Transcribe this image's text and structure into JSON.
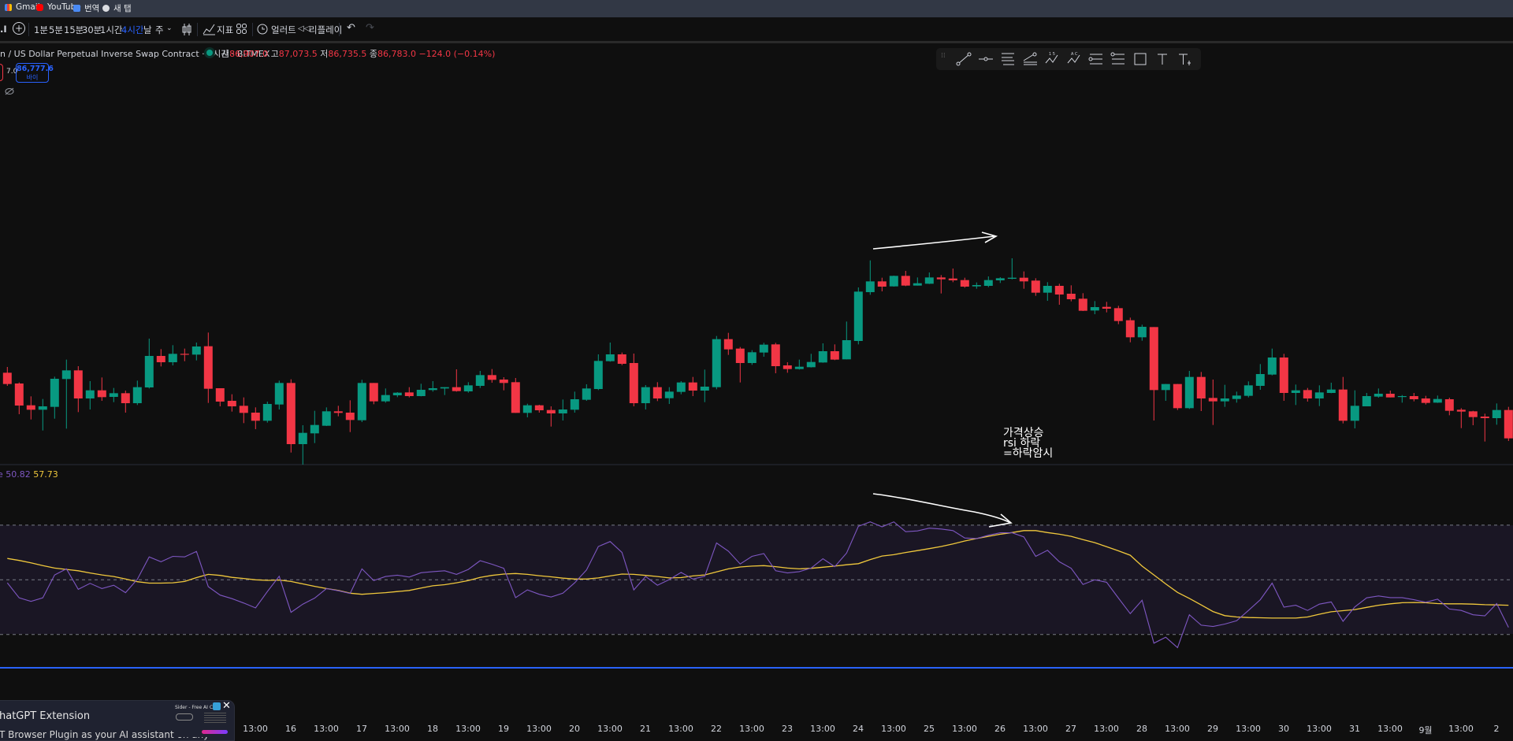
{
  "bookmarks": [
    {
      "label": "Gmail",
      "icon": "gmail-icon"
    },
    {
      "label": "YouTube",
      "icon": "youtube-icon"
    },
    {
      "label": "번역",
      "icon": "translate-icon"
    },
    {
      "label": "새 탭",
      "icon": "globe-icon"
    }
  ],
  "toolbar": {
    "symbol_fragment": ".I",
    "intervals": [
      "1분",
      "5분",
      "15분",
      "30분",
      "1시간",
      "4시간",
      "날",
      "주"
    ],
    "active_interval": "4시간",
    "indicators_label": "지표",
    "alert_label": "얼러트",
    "replay_label": "리플레이"
  },
  "legend": {
    "symbol_title": "n / US Dollar Perpetual Inverse Swap Contract · 4시간 · BITMEX",
    "open_label": "시",
    "open": "86,907.0",
    "high_label": "고",
    "high": "87,073.5",
    "low_label": "저",
    "low": "86,735.5",
    "close_label": "종",
    "close": "86,783.0",
    "change": "−124.0 (−0.14%)",
    "spread": "7.0",
    "buy_price": "86,777.6",
    "buy_label": "바이"
  },
  "drawing_tools": [
    "trend-line-icon",
    "horizontal-ray-icon",
    "parallel-channel-icon",
    "fib-retracement-icon",
    "elliott-wave-icon",
    "abcd-pattern-icon",
    "long-position-icon",
    "short-position-icon",
    "rectangle-icon",
    "text-icon",
    "anchored-text-icon"
  ],
  "annotation_text": [
    "가격상승",
    "rsi 하락",
    "=하락암시"
  ],
  "rsi_legend": {
    "prefix": "e",
    "rsi": "50.82",
    "rsi_ma": "57.73"
  },
  "colors": {
    "up": "#089981",
    "down": "#f23645",
    "rsi": "#7e57c2",
    "rsi_ma": "#f0c83c",
    "accent": "#2962ff"
  },
  "time_axis": [
    "13:00",
    "16",
    "13:00",
    "17",
    "13:00",
    "18",
    "13:00",
    "19",
    "13:00",
    "20",
    "13:00",
    "21",
    "13:00",
    "22",
    "13:00",
    "23",
    "13:00",
    "24",
    "13:00",
    "25",
    "13:00",
    "26",
    "13:00",
    "27",
    "13:00",
    "28",
    "13:00",
    "29",
    "13:00",
    "30",
    "13:00",
    "31",
    "13:00",
    "9월",
    "13:00",
    "2"
  ],
  "popup": {
    "title": "hatGPT Extension",
    "body": "T Browser Plugin as your AI assistant on any",
    "ad_title": "Sider - Free AI C"
  },
  "chart_data": {
    "type": "candlestick",
    "interval": "4h",
    "candles": [
      [
        87033,
        87055,
        86983,
        86990
      ],
      [
        86992,
        86996,
        86875,
        86908
      ],
      [
        86909,
        86943,
        86855,
        86892
      ],
      [
        86892,
        86933,
        86813,
        86905
      ],
      [
        86903,
        87018,
        86858,
        87010
      ],
      [
        87009,
        87083,
        86820,
        87042
      ],
      [
        87042,
        87058,
        86883,
        86935
      ],
      [
        86935,
        87001,
        86893,
        86966
      ],
      [
        86966,
        87015,
        86926,
        86940
      ],
      [
        86941,
        86975,
        86921,
        86955
      ],
      [
        86955,
        86965,
        86881,
        86917
      ],
      [
        86917,
        87003,
        86910,
        86978
      ],
      [
        86977,
        87163,
        86973,
        87097
      ],
      [
        87097,
        87123,
        87057,
        87073
      ],
      [
        87073,
        87138,
        87061,
        87105
      ],
      [
        87105,
        87125,
        87077,
        87102
      ],
      [
        87102,
        87148,
        87080,
        87133
      ],
      [
        87134,
        87186,
        86918,
        86972
      ],
      [
        86974,
        86974,
        86905,
        86923
      ],
      [
        86926,
        86951,
        86885,
        86905
      ],
      [
        86907,
        86939,
        86841,
        86880
      ],
      [
        86881,
        86901,
        86818,
        86850
      ],
      [
        86850,
        86923,
        86843,
        86914
      ],
      [
        86912,
        87003,
        86893,
        86994
      ],
      [
        86994,
        87008,
        86729,
        86761
      ],
      [
        86761,
        86833,
        86683,
        86804
      ],
      [
        86802,
        86888,
        86765,
        86834
      ],
      [
        86831,
        86901,
        86830,
        86886
      ],
      [
        86886,
        86907,
        86867,
        86880
      ],
      [
        86881,
        86928,
        86807,
        86853
      ],
      [
        86852,
        87006,
        86845,
        86994
      ],
      [
        86994,
        86994,
        86913,
        86924
      ],
      [
        86924,
        86973,
        86919,
        86948
      ],
      [
        86947,
        86959,
        86940,
        86957
      ],
      [
        86958,
        86978,
        86939,
        86944
      ],
      [
        86944,
        86991,
        86943,
        86968
      ],
      [
        86967,
        87001,
        86961,
        86974
      ],
      [
        86973,
        86978,
        86948,
        86978
      ],
      [
        86978,
        87046,
        86961,
        86963
      ],
      [
        86962,
        86997,
        86957,
        86985
      ],
      [
        86983,
        87040,
        86975,
        87024
      ],
      [
        87024,
        87047,
        86995,
        87006
      ],
      [
        87007,
        87016,
        86966,
        86994
      ],
      [
        86997,
        87013,
        86880,
        86880
      ],
      [
        86880,
        86915,
        86863,
        86909
      ],
      [
        86909,
        86911,
        86881,
        86890
      ],
      [
        86891,
        86905,
        86828,
        86878
      ],
      [
        86878,
        86931,
        86851,
        86893
      ],
      [
        86892,
        86961,
        86881,
        86932
      ],
      [
        86930,
        86989,
        86926,
        86973
      ],
      [
        86971,
        87103,
        86967,
        87078
      ],
      [
        87077,
        87148,
        87075,
        87103
      ],
      [
        87103,
        87110,
        87062,
        87067
      ],
      [
        87070,
        87106,
        86905,
        86917
      ],
      [
        86917,
        86986,
        86893,
        86978
      ],
      [
        86978,
        86997,
        86925,
        86935
      ],
      [
        86936,
        86978,
        86914,
        86961
      ],
      [
        86960,
        87001,
        86951,
        86996
      ],
      [
        86996,
        87017,
        86944,
        86965
      ],
      [
        86965,
        87045,
        86921,
        86980
      ],
      [
        86978,
        87173,
        86970,
        87161
      ],
      [
        87161,
        87185,
        87101,
        87122
      ],
      [
        87125,
        87131,
        86996,
        87070
      ],
      [
        87070,
        87119,
        87063,
        87111
      ],
      [
        87110,
        87147,
        87094,
        87140
      ],
      [
        87141,
        87147,
        87031,
        87058
      ],
      [
        87061,
        87073,
        87033,
        87047
      ],
      [
        87047,
        87083,
        87045,
        87056
      ],
      [
        87054,
        87105,
        87053,
        87074
      ],
      [
        87072,
        87145,
        87071,
        87115
      ],
      [
        87115,
        87141,
        87081,
        87083
      ],
      [
        87084,
        87228,
        87084,
        87157
      ],
      [
        87154,
        87358,
        87141,
        87342
      ],
      [
        87340,
        87461,
        87330,
        87381
      ],
      [
        87381,
        87395,
        87343,
        87361
      ],
      [
        87362,
        87403,
        87361,
        87402
      ],
      [
        87402,
        87421,
        87363,
        87365
      ],
      [
        87365,
        87396,
        87365,
        87374
      ],
      [
        87372,
        87415,
        87371,
        87396
      ],
      [
        87396,
        87405,
        87335,
        87389
      ],
      [
        87392,
        87430,
        87378,
        87385
      ],
      [
        87386,
        87395,
        87357,
        87361
      ],
      [
        87362,
        87377,
        87353,
        87367
      ],
      [
        87364,
        87400,
        87359,
        87386
      ],
      [
        87385,
        87397,
        87375,
        87393
      ],
      [
        87391,
        87469,
        87389,
        87395
      ],
      [
        87395,
        87419,
        87353,
        87381
      ],
      [
        87384,
        87393,
        87326,
        87338
      ],
      [
        87338,
        87378,
        87307,
        87364
      ],
      [
        87364,
        87372,
        87292,
        87331
      ],
      [
        87334,
        87366,
        87305,
        87313
      ],
      [
        87315,
        87336,
        87268,
        87269
      ],
      [
        87270,
        87306,
        87256,
        87283
      ],
      [
        87284,
        87303,
        87263,
        87277
      ],
      [
        87279,
        87288,
        87218,
        87230
      ],
      [
        87233,
        87243,
        87149,
        87168
      ],
      [
        87168,
        87216,
        87155,
        87208
      ],
      [
        87207,
        87207,
        86851,
        86967
      ],
      [
        86967,
        86990,
        86926,
        86990
      ],
      [
        86990,
        86990,
        86891,
        86898
      ],
      [
        86898,
        87040,
        86895,
        87017
      ],
      [
        87017,
        87036,
        86887,
        86935
      ],
      [
        86937,
        87007,
        86834,
        86924
      ],
      [
        86924,
        86987,
        86903,
        86935
      ],
      [
        86933,
        86961,
        86919,
        86946
      ],
      [
        86945,
        87000,
        86939,
        86985
      ],
      [
        86983,
        87066,
        86968,
        87028
      ],
      [
        87026,
        87125,
        87023,
        87091
      ],
      [
        87091,
        87105,
        86926,
        86956
      ],
      [
        86956,
        86988,
        86910,
        86966
      ],
      [
        86967,
        86975,
        86923,
        86935
      ],
      [
        86935,
        86985,
        86906,
        86958
      ],
      [
        86956,
        86995,
        86955,
        86969
      ],
      [
        86969,
        87017,
        86840,
        86850
      ],
      [
        86850,
        86966,
        86821,
        86907
      ],
      [
        86905,
        86956,
        86905,
        86944
      ],
      [
        86942,
        86973,
        86938,
        86953
      ],
      [
        86953,
        86965,
        86939,
        86939
      ],
      [
        86942,
        86948,
        86919,
        86944
      ],
      [
        86944,
        86956,
        86924,
        86932
      ],
      [
        86935,
        86945,
        86912,
        86918
      ],
      [
        86919,
        86946,
        86918,
        86933
      ],
      [
        86932,
        86938,
        86871,
        86888
      ],
      [
        86892,
        86898,
        86822,
        86885
      ],
      [
        86886,
        86888,
        86833,
        86864
      ],
      [
        86866,
        86877,
        86771,
        86860
      ],
      [
        86860,
        86916,
        86835,
        86891
      ],
      [
        86891,
        86903,
        86773,
        86783
      ]
    ],
    "price_range": [
      86650,
      87500
    ],
    "rsi": [
      48.9,
      43.4,
      42.1,
      43.4,
      51.8,
      54.0,
      46.5,
      48.7,
      46.8,
      48.0,
      45.3,
      50.2,
      58.4,
      56.6,
      58.6,
      58.4,
      60.4,
      47.5,
      44.4,
      43.1,
      41.5,
      39.7,
      45.7,
      51.3,
      38.1,
      41.1,
      43.3,
      46.8,
      46.0,
      45.0,
      54.0,
      49.7,
      51.2,
      51.7,
      51.0,
      52.6,
      53.0,
      53.3,
      52.0,
      53.8,
      57.0,
      55.7,
      54.2,
      43.5,
      46.3,
      44.7,
      43.7,
      45.1,
      48.9,
      53.6,
      62.2,
      64.0,
      60.0,
      46.3,
      51.2,
      48.0,
      50.1,
      52.7,
      50.3,
      51.3,
      63.5,
      60.5,
      55.8,
      58.6,
      59.6,
      53.3,
      52.5,
      53.0,
      54.3,
      57.7,
      54.8,
      59.8,
      69.6,
      71.2,
      69.4,
      71.2,
      67.6,
      67.9,
      68.9,
      68.6,
      68.0,
      65.3,
      65.1,
      66.3,
      67.2,
      67.2,
      65.7,
      58.6,
      60.8,
      56.6,
      54.2,
      48.3,
      50.0,
      49.1,
      43.3,
      37.6,
      42.5,
      26.8,
      29.0,
      25.2,
      37.2,
      33.4,
      32.9,
      33.8,
      35.0,
      38.8,
      42.7,
      48.8,
      40.0,
      40.7,
      38.8,
      41.1,
      41.9,
      34.8,
      40.1,
      43.4,
      44.1,
      43.5,
      43.5,
      42.7,
      41.8,
      42.9,
      39.3,
      38.8,
      37.2,
      36.8,
      41.3,
      32.6
    ],
    "rsi_ma": [
      57.8,
      57.1,
      56.2,
      55.2,
      54.3,
      53.8,
      53.3,
      52.5,
      51.8,
      51.2,
      50.3,
      49.3,
      48.8,
      48.8,
      48.9,
      49.4,
      50.8,
      52.0,
      51.6,
      50.9,
      50.5,
      50.0,
      49.8,
      49.9,
      49.4,
      48.5,
      47.6,
      46.8,
      46.1,
      45.1,
      44.7,
      45.0,
      45.3,
      45.7,
      46.1,
      47.0,
      47.8,
      48.2,
      48.9,
      49.7,
      50.9,
      51.6,
      52.1,
      52.3,
      52.0,
      51.5,
      51.1,
      50.6,
      50.3,
      50.3,
      50.7,
      51.4,
      52.1,
      52.0,
      51.6,
      51.2,
      50.7,
      50.8,
      51.4,
      51.8,
      52.9,
      54.0,
      54.7,
      55.0,
      55.2,
      54.8,
      54.3,
      54.0,
      54.2,
      54.6,
      55.0,
      55.5,
      55.9,
      57.4,
      58.7,
      59.2,
      60.0,
      60.7,
      61.4,
      62.2,
      63.1,
      64.2,
      65.1,
      65.9,
      66.7,
      67.3,
      68.0,
      68.0,
      67.3,
      66.7,
      65.9,
      64.7,
      63.6,
      62.1,
      60.6,
      59.0,
      55.0,
      51.8,
      48.5,
      45.4,
      43.2,
      40.8,
      38.4,
      36.9,
      36.4,
      36.2,
      36.1,
      36.0,
      36.0,
      36.0,
      36.4,
      37.4,
      38.3,
      38.7,
      39.1,
      39.9,
      40.7,
      41.2,
      41.6,
      41.7,
      41.6,
      41.3,
      41.2,
      41.2,
      41.1,
      40.9,
      40.8,
      40.7
    ],
    "rsi_levels": [
      70,
      50,
      30
    ]
  }
}
